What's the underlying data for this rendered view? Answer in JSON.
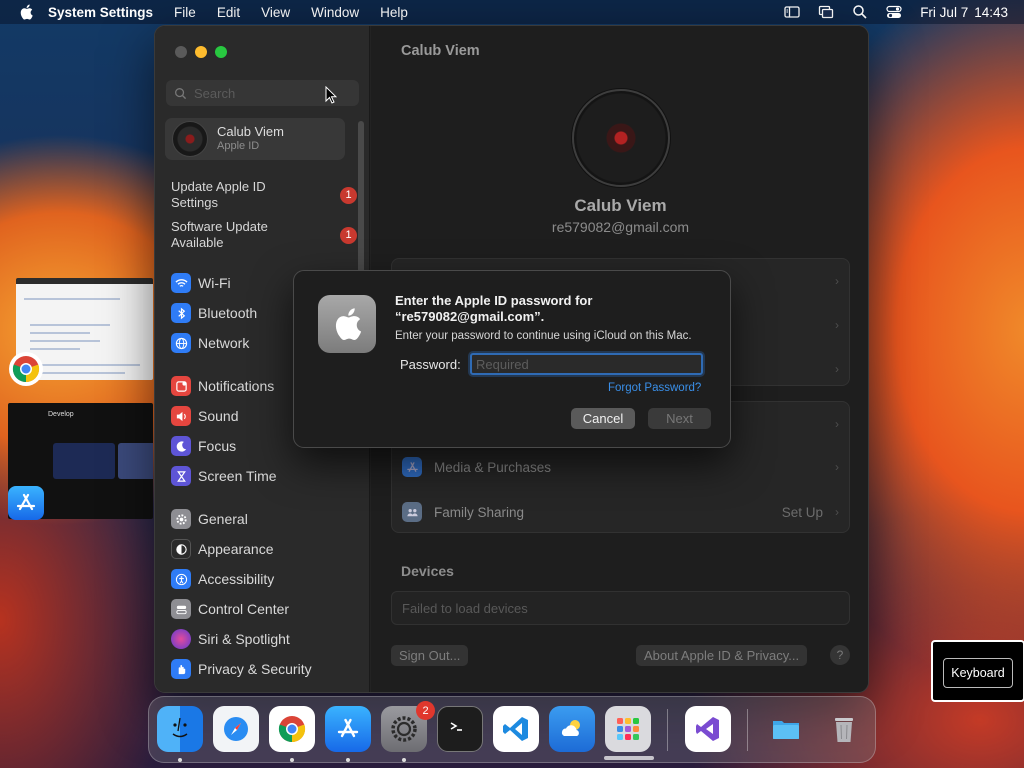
{
  "menubar": {
    "app_name": "System Settings",
    "menus": [
      "File",
      "Edit",
      "View",
      "Window",
      "Help"
    ],
    "clock": {
      "date": "Fri Jul 7",
      "time": "14:43"
    }
  },
  "window": {
    "sidebar": {
      "search_placeholder": "Search",
      "account": {
        "name": "Calub Viem",
        "subtitle": "Apple ID"
      },
      "notices": [
        {
          "label": "Update Apple ID Settings",
          "badge": "1"
        },
        {
          "label": "Software Update Available",
          "badge": "1"
        }
      ],
      "items": [
        {
          "label": "Wi-Fi",
          "icon": "wifi-icon",
          "color": "#2f7cf6"
        },
        {
          "label": "Bluetooth",
          "icon": "bluetooth-icon",
          "color": "#2f7cf6"
        },
        {
          "label": "Network",
          "icon": "globe-icon",
          "color": "#2f7cf6"
        },
        {
          "label": "Notifications",
          "icon": "bell-icon",
          "color": "#e5463f"
        },
        {
          "label": "Sound",
          "icon": "speaker-icon",
          "color": "#e5463f"
        },
        {
          "label": "Focus",
          "icon": "moon-icon",
          "color": "#5e55d6"
        },
        {
          "label": "Screen Time",
          "icon": "hourglass-icon",
          "color": "#5e55d6"
        },
        {
          "label": "General",
          "icon": "gear-icon",
          "color": "#8e8e93"
        },
        {
          "label": "Appearance",
          "icon": "appearance-icon",
          "color": "#2b2b2b"
        },
        {
          "label": "Accessibility",
          "icon": "accessibility-icon",
          "color": "#2f7cf6"
        },
        {
          "label": "Control Center",
          "icon": "control-center-icon",
          "color": "#8e8e93"
        },
        {
          "label": "Siri & Spotlight",
          "icon": "siri-icon",
          "color": "#c0429b"
        },
        {
          "label": "Privacy & Security",
          "icon": "hand-icon",
          "color": "#2f7cf6"
        }
      ]
    },
    "main": {
      "title": "Calub Viem",
      "profile": {
        "name": "Calub Viem",
        "email": "re579082@gmail.com"
      },
      "rows": [
        {
          "label": "Media & Purchases",
          "icon": "app-store-icon",
          "value": ""
        },
        {
          "label": "Family Sharing",
          "icon": "family-icon",
          "value": "Set Up"
        }
      ],
      "devices": {
        "title": "Devices",
        "status": "Failed to load devices"
      },
      "buttons": {
        "sign_out": "Sign Out...",
        "about": "About Apple ID & Privacy...",
        "help": "?"
      }
    }
  },
  "dialog": {
    "title": "Enter the Apple ID password for “re579082@gmail.com”.",
    "message": "Enter your password to continue using iCloud on this Mac.",
    "password_label": "Password:",
    "password_placeholder": "Required",
    "forgot": "Forgot Password?",
    "cancel": "Cancel",
    "next": "Next"
  },
  "overlay": {
    "keyboard_label": "Keyboard"
  },
  "dock": {
    "apps": [
      {
        "name": "Finder",
        "icon": "finder-icon",
        "color": "#1e8af0"
      },
      {
        "name": "Safari",
        "icon": "safari-icon",
        "color": "#f5f7fa"
      },
      {
        "name": "Chrome",
        "icon": "chrome-icon",
        "color": "#ffffff"
      },
      {
        "name": "App Store",
        "icon": "app-store-icon",
        "color": "#1d7cf0"
      },
      {
        "name": "System Settings",
        "icon": "gear-icon",
        "color": "#8e8e93",
        "badge": "2"
      },
      {
        "name": "Terminal",
        "icon": "terminal-icon",
        "color": "#1d1d1d"
      },
      {
        "name": "VS Code",
        "icon": "vscode-icon",
        "color": "#ffffff"
      },
      {
        "name": "Weather",
        "icon": "weather-icon",
        "color": "#2f86e8"
      },
      {
        "name": "Launchpad",
        "icon": "launchpad-icon",
        "color": "#d8d8dc"
      },
      {
        "name": "Visual Studio",
        "icon": "visual-studio-icon",
        "color": "#ffffff"
      },
      {
        "name": "Downloads",
        "icon": "folder-icon",
        "color": "#4ab2ee"
      },
      {
        "name": "Trash",
        "icon": "trash-icon",
        "color": "#b8b8bc"
      }
    ]
  }
}
